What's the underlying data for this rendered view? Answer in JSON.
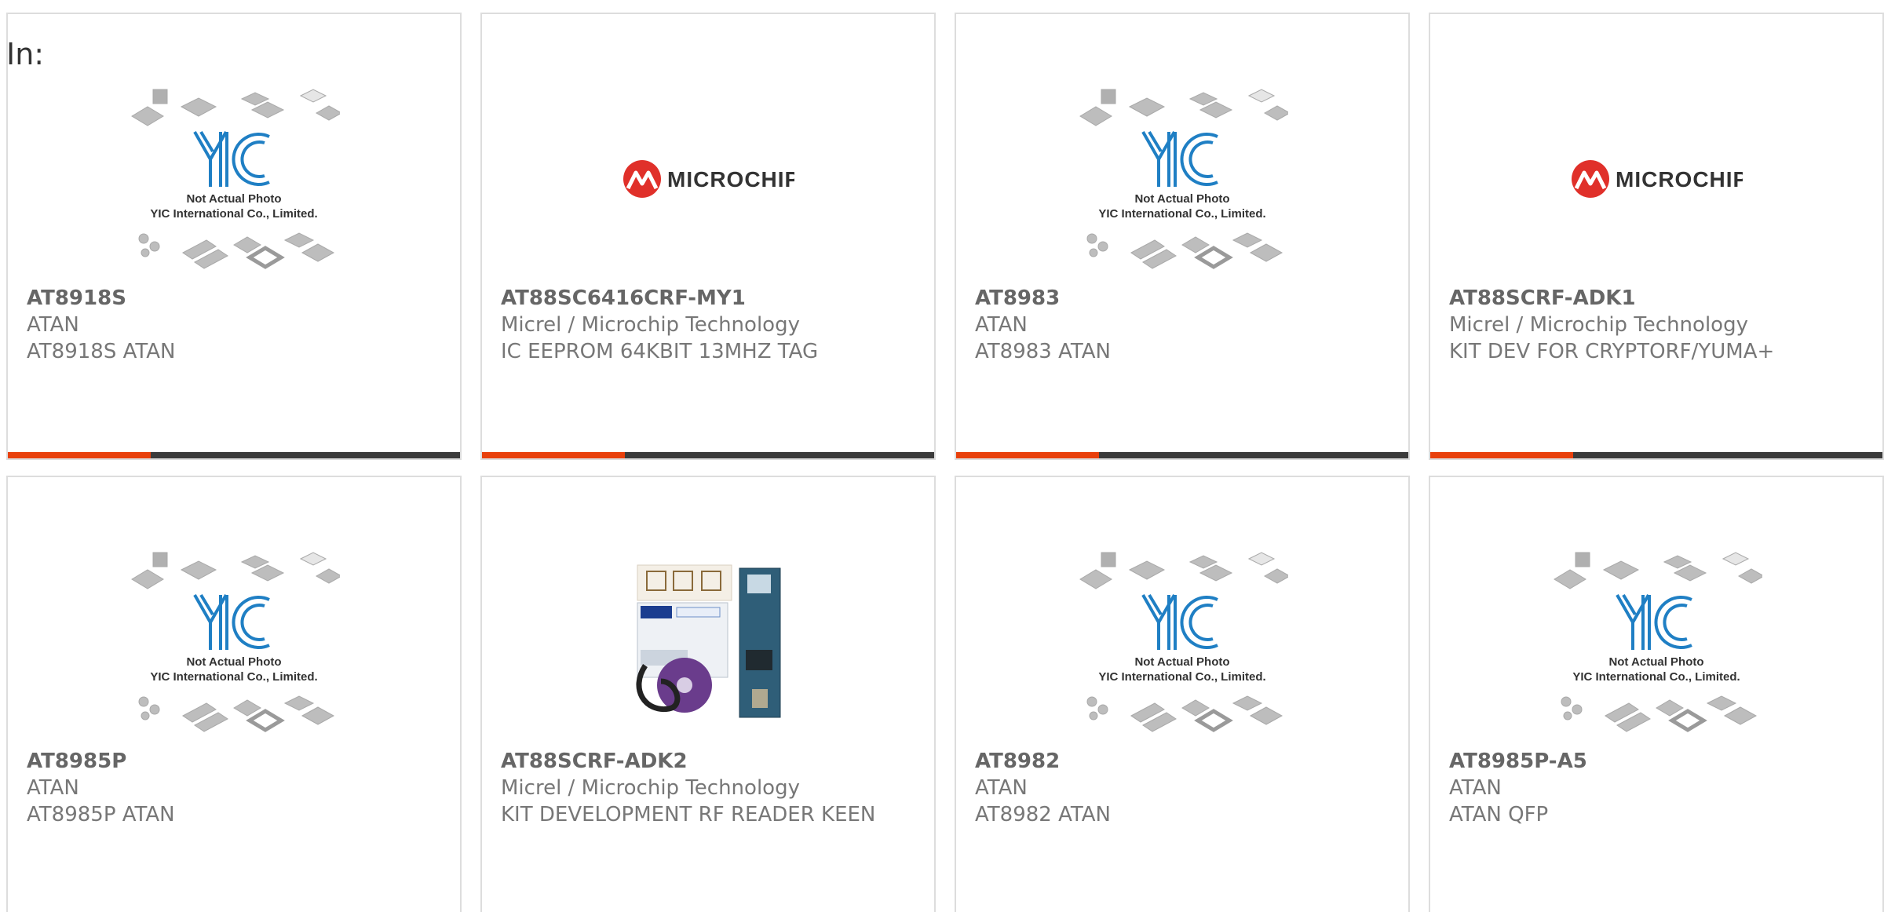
{
  "header": {
    "in_label": "In:"
  },
  "yic_placeholder": {
    "caption_line1": "Not Actual Photo",
    "caption_line2": "YIC International Co., Limited."
  },
  "microchip_logo": {
    "text": "MICROCHIP"
  },
  "colors": {
    "accent": "#e8400c",
    "bar_dark": "#3b3b3b",
    "yic_blue": "#1f7fc4",
    "microchip_red": "#e0302a"
  },
  "products": [
    {
      "part": "AT8918S",
      "manufacturer": "ATAN",
      "description": "AT8918S ATAN",
      "image": "yic-placeholder"
    },
    {
      "part": "AT88SC6416CRF-MY1",
      "manufacturer": "Micrel / Microchip Technology",
      "description": "IC EEPROM 64KBIT 13MHZ TAG",
      "image": "microchip-logo"
    },
    {
      "part": "AT8983",
      "manufacturer": "ATAN",
      "description": "AT8983 ATAN",
      "image": "yic-placeholder"
    },
    {
      "part": "AT88SCRF-ADK1",
      "manufacturer": "Micrel / Microchip Technology",
      "description": "KIT DEV FOR CRYPTORF/YUMA+",
      "image": "microchip-logo"
    },
    {
      "part": "AT8985P",
      "manufacturer": "ATAN",
      "description": "AT8985P ATAN",
      "image": "yic-placeholder"
    },
    {
      "part": "AT88SCRF-ADK2",
      "manufacturer": "Micrel / Microchip Technology",
      "description": "KIT DEVELOPMENT RF READER KEEN",
      "image": "kit-photo"
    },
    {
      "part": "AT8982",
      "manufacturer": "ATAN",
      "description": "AT8982 ATAN",
      "image": "yic-placeholder"
    },
    {
      "part": "AT8985P-A5",
      "manufacturer": "ATAN",
      "description": "ATAN QFP",
      "image": "yic-placeholder"
    }
  ]
}
